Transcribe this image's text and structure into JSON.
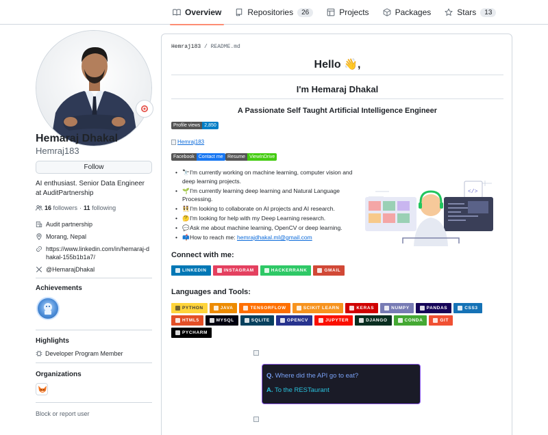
{
  "nav": {
    "tabs": [
      {
        "label": "Overview",
        "icon": "book-icon",
        "active": true
      },
      {
        "label": "Repositories",
        "icon": "repo-icon",
        "count": "26"
      },
      {
        "label": "Projects",
        "icon": "table-icon"
      },
      {
        "label": "Packages",
        "icon": "package-icon"
      },
      {
        "label": "Stars",
        "icon": "star-icon",
        "count": "13"
      }
    ]
  },
  "profile": {
    "name": "Hemaraj Dhakal",
    "login": "Hemraj183",
    "follow_label": "Follow",
    "bio": "AI enthusiast. Senior Data Engineer at AuditPartnership",
    "followers_count": "16",
    "followers_label": "followers",
    "separator": "·",
    "following_count": "11",
    "following_label": "following",
    "company": "Audit partnership",
    "location": "Morang, Nepal",
    "website": "https://www.linkedin.com/in/hemaraj-dhakal-155b1b1a7/",
    "twitter": "@HemarajDhakal",
    "achievements_title": "Achievements",
    "highlights_title": "Highlights",
    "highlight_item": "Developer Program Member",
    "organizations_title": "Organizations",
    "report_label": "Block or report user"
  },
  "readme": {
    "path_user": "Hemraj183",
    "path_sep": " / ",
    "path_file": "README.md",
    "hello": "Hello 👋,",
    "intro": "I'm Hemaraj Dhakal",
    "tagline": "A Passionate Self Taught Artificial Intelligence Engineer",
    "profile_views": {
      "label": "Profile views",
      "value": "2,850",
      "color": "#007ec6"
    },
    "broken_link": "Hemraj183",
    "facebook": {
      "label": "Facebook",
      "value": "Contact me",
      "color": "#1877f2"
    },
    "resume": {
      "label": "Resume",
      "value": "ViewInDrive",
      "color": "#4c1"
    },
    "bullets": [
      {
        "emoji": "🔭",
        "text": "I'm currently working on machine learning, computer vision and deep learning projects."
      },
      {
        "emoji": "🌱",
        "text": "I'm currently learning deep learning and Natural Language Processing."
      },
      {
        "emoji": "👯",
        "text": "I'm looking to collaborate on AI projects and AI research."
      },
      {
        "emoji": "🤔",
        "text": "I'm looking for help with my Deep Learning research."
      },
      {
        "emoji": "💬",
        "text": "Ask me about machine learning, OpenCV or deep learning."
      }
    ],
    "reach": {
      "emoji": "📫",
      "text": "How to reach me: ",
      "email": "hemrajdhakal.ml@gmail.com"
    },
    "connect_title": "Connect with me:",
    "connect": [
      {
        "label": "LINKEDIN",
        "color": "#0077b5"
      },
      {
        "label": "INSTAGRAM",
        "color": "#e4405f"
      },
      {
        "label": "HACKERRANK",
        "color": "#2ec866"
      },
      {
        "label": "GMAIL",
        "color": "#d14836"
      }
    ],
    "tools_title": "Languages and Tools:",
    "tools": [
      {
        "label": "PYTHON",
        "color": "#ffd43b",
        "text": "#3b3b3b"
      },
      {
        "label": "JAVA",
        "color": "#ed8b00",
        "text": "#ffffff"
      },
      {
        "label": "TENSORFLOW",
        "color": "#ff6f00",
        "text": "#ffffff"
      },
      {
        "label": "SCIKIT LEARN",
        "color": "#f7931e",
        "text": "#ffffff"
      },
      {
        "label": "KERAS",
        "color": "#d00000",
        "text": "#ffffff"
      },
      {
        "label": "NUMPY",
        "color": "#777bb4",
        "text": "#ffffff"
      },
      {
        "label": "PANDAS",
        "color": "#150458",
        "text": "#ffffff"
      },
      {
        "label": "CSS3",
        "color": "#1572b6",
        "text": "#ffffff"
      },
      {
        "label": "HTML5",
        "color": "#e34f26",
        "text": "#ffffff"
      },
      {
        "label": "MYSQL",
        "color": "#00000f",
        "text": "#ffffff"
      },
      {
        "label": "SQLITE",
        "color": "#07405e",
        "text": "#ffffff"
      },
      {
        "label": "OPENCV",
        "color": "#27338e",
        "text": "#ffffff"
      },
      {
        "label": "JUPYTER",
        "color": "#fa0f00",
        "text": "#ffffff"
      },
      {
        "label": "DJANGO",
        "color": "#092e20",
        "text": "#ffffff"
      },
      {
        "label": "CONDA",
        "color": "#342b029",
        "text": "#ffffff"
      },
      {
        "label": "GIT",
        "color": "#f05033",
        "text": "#ffffff"
      },
      {
        "label": "PYCHARM",
        "color": "#000000",
        "text": "#ffffff"
      }
    ],
    "joke_q_prefix": "Q.",
    "joke_q": "Where did the API go to eat?",
    "joke_a_prefix": "A.",
    "joke_a": "To the RESTaurant",
    "colors": {
      "joke_bg": "#1a1b27",
      "joke_border": "#8f5cf2",
      "joke_q": "#7aa2f7",
      "joke_a": "#2ac3de",
      "tab_underline": "#fd8c73",
      "link": "#0969da"
    }
  }
}
